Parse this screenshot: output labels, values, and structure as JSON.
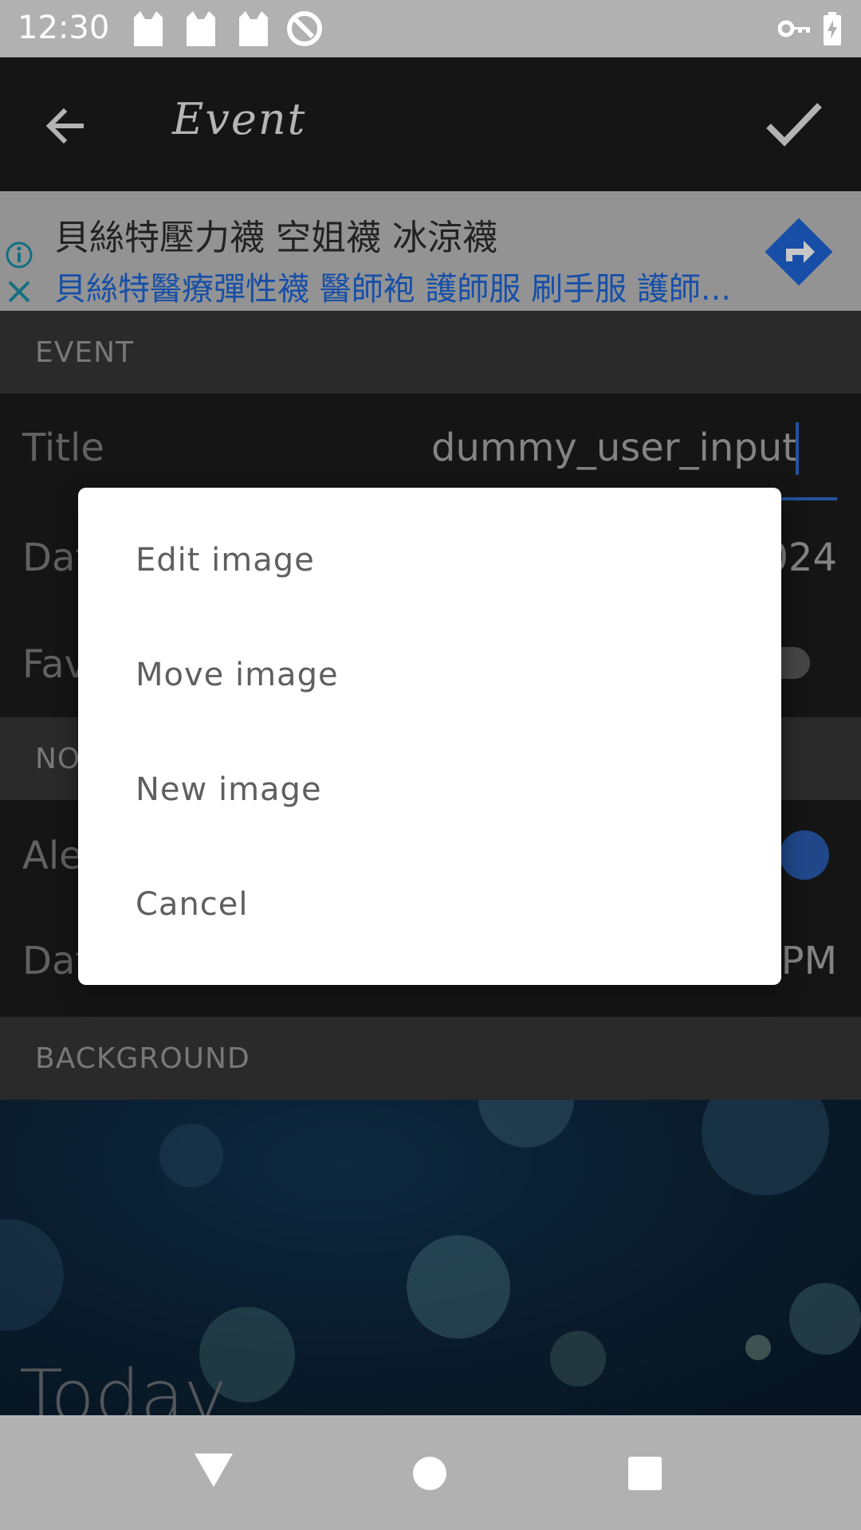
{
  "status_bar": {
    "time": "12:30",
    "icons": [
      "cat-notification-icon",
      "cat-notification-icon",
      "cat-notification-icon",
      "data-saver-icon",
      "vpn-key-icon",
      "battery-charging-icon"
    ]
  },
  "app_bar": {
    "title": "Event",
    "back_icon": "arrow-left-icon",
    "confirm_icon": "check-icon"
  },
  "ad_banner": {
    "headline": "貝絲特壓力襪 空姐襪 冰涼襪",
    "subline": "貝絲特醫療彈性襪 醫師袍 護師服 刷手服 護師...",
    "info_icon": "info-icon",
    "close_icon": "close-icon",
    "action_icon": "directions-icon",
    "accent_color": "#1e66d8"
  },
  "event_section": {
    "header": "EVENT",
    "rows": [
      {
        "label": "Title",
        "value": "dummy_user_input"
      },
      {
        "label": "Dat",
        "value": "024"
      },
      {
        "label": "Fav",
        "value": ""
      }
    ]
  },
  "notification_section": {
    "header": "NO",
    "rows": [
      {
        "label": "Ale",
        "value": ""
      },
      {
        "label": "Dat",
        "value": "PM"
      }
    ]
  },
  "background_section": {
    "header": "BACKGROUND",
    "caption": "Today"
  },
  "dialog": {
    "items": [
      "Edit image",
      "Move image",
      "New image",
      "Cancel"
    ]
  },
  "nav_bar": {
    "icons": [
      "back-triangle-icon",
      "home-circle-icon",
      "recents-square-icon"
    ]
  }
}
